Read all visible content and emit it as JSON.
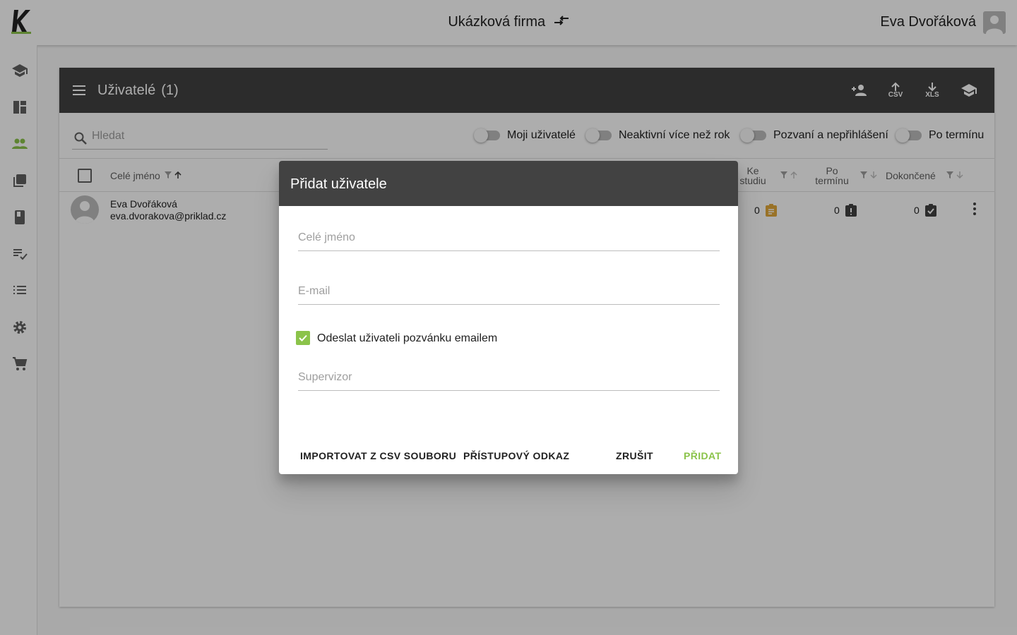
{
  "colors": {
    "accent": "#8bc34a",
    "header": "#424242",
    "clipboard": "#e2a83a"
  },
  "topbar": {
    "company": "Ukázková firma",
    "user": "Eva Dvořáková"
  },
  "sidebar": {
    "items": [
      "school-icon",
      "dashboard-icon",
      "people-icon",
      "library-icon",
      "book-icon",
      "playlist-check-icon",
      "list-icon",
      "settings-icon",
      "cart-icon"
    ]
  },
  "card": {
    "title": "Uživatelé",
    "count": "(1)",
    "actions": {
      "csv": "CSV",
      "xls": "XLS"
    }
  },
  "search": {
    "placeholder": "Hledat"
  },
  "filters": [
    "Moji uživatelé",
    "Neaktivní více než rok",
    "Pozvaní a nepřihlášení",
    "Po termínu"
  ],
  "table": {
    "headers": {
      "name": "Celé jméno",
      "study_1": "Ke",
      "study_2": "studiu",
      "overdue_1": "Po",
      "overdue_2": "termínu",
      "done": "Dokončené"
    },
    "rows": [
      {
        "name": "Eva Dvořáková",
        "email": "eva.dvorakova@priklad.cz",
        "study": "0",
        "overdue": "0",
        "done": "0"
      }
    ]
  },
  "dialog": {
    "title": "Přidat uživatele",
    "name_placeholder": "Celé jméno",
    "email_placeholder": "E-mail",
    "invite_label": "Odeslat uživateli pozvánku emailem",
    "invite_checked": true,
    "supervisor_placeholder": "Supervizor",
    "buttons": {
      "import": "IMPORTOVAT Z CSV SOUBORU",
      "link": "PŘÍSTUPOVÝ ODKAZ",
      "cancel": "ZRUŠIT",
      "add": "PŘIDAT"
    }
  }
}
